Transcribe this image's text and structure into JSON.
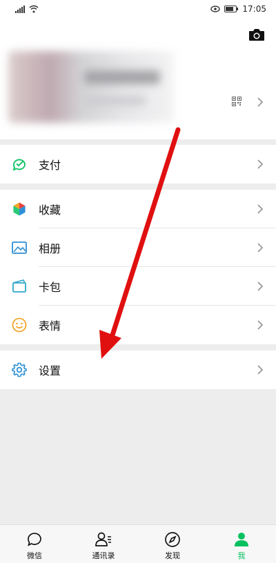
{
  "status_bar": {
    "time": "17:05"
  },
  "menu": {
    "pay": {
      "label": "支付"
    },
    "favorites": {
      "label": "收藏"
    },
    "album": {
      "label": "相册"
    },
    "cards": {
      "label": "卡包"
    },
    "stickers": {
      "label": "表情"
    },
    "settings": {
      "label": "设置"
    }
  },
  "tabbar": {
    "items": [
      {
        "label": "微信",
        "icon": "chat-bubble-icon"
      },
      {
        "label": "通讯录",
        "icon": "contacts-icon"
      },
      {
        "label": "发现",
        "icon": "compass-icon"
      },
      {
        "label": "我",
        "icon": "me-icon",
        "active": true
      }
    ]
  },
  "colors": {
    "accent": "#07c160",
    "pay_icon": "#07c160",
    "album_icon": "#2e8fd6",
    "cards_icon": "#2ea6c9",
    "stickers_icon": "#f0a52a",
    "settings_icon": "#2e8fd6",
    "annotation_arrow": "#e01010"
  }
}
